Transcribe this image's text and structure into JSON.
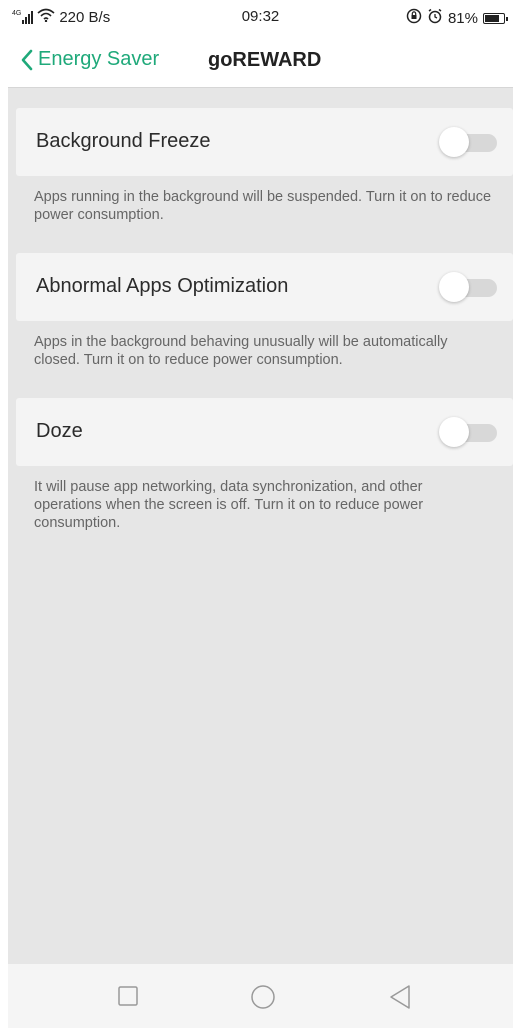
{
  "status_bar": {
    "network_type": "4G",
    "speed": "220 B/s",
    "time": "09:32",
    "battery": "81%",
    "battery_level": 0.81,
    "icons": [
      "signal-icon",
      "wifi-icon",
      "lock-rotation-icon",
      "alarm-icon",
      "battery-icon"
    ]
  },
  "header": {
    "back_label": "Energy Saver",
    "title": "goREWARD",
    "accent_color": "#1fa97a"
  },
  "settings": [
    {
      "label": "Background Freeze",
      "enabled": false,
      "description": "Apps running in the background will be suspended. Turn it on to reduce power consumption."
    },
    {
      "label": "Abnormal Apps Optimization",
      "enabled": false,
      "description": "Apps in the background behaving unusually will be automatically closed. Turn it on to reduce power consumption."
    },
    {
      "label": "Doze",
      "enabled": false,
      "description": "It will pause app networking, data synchronization, and other operations when the screen is off. Turn it on to reduce power consumption."
    }
  ],
  "nav_bar": {
    "buttons": [
      "recents-icon",
      "home-icon",
      "back-icon"
    ]
  }
}
